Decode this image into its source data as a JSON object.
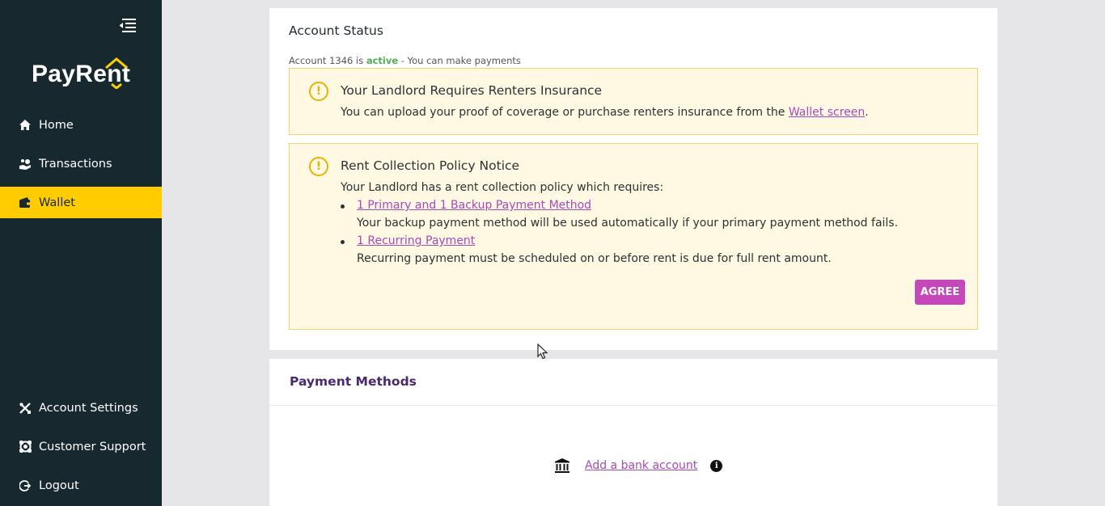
{
  "sidebar": {
    "brand": "PayRent",
    "items": [
      {
        "label": "Home",
        "icon": "home-icon"
      },
      {
        "label": "Transactions",
        "icon": "hand-coin-icon"
      },
      {
        "label": "Wallet",
        "icon": "wallet-icon"
      }
    ],
    "bottom_items": [
      {
        "label": "Account Settings",
        "icon": "tools-icon"
      },
      {
        "label": "Customer Support",
        "icon": "support-icon"
      },
      {
        "label": "Logout",
        "icon": "logout-icon"
      }
    ],
    "active_item": "Wallet"
  },
  "account_status": {
    "title": "Account Status",
    "line_prefix": "Account 1346 is ",
    "line_status": "active",
    "line_suffix": " - You can make payments"
  },
  "insurance_alert": {
    "heading": "Your Landlord Requires Renters Insurance",
    "body_prefix": "You can upload your proof of coverage or purchase renters insurance from the ",
    "body_link": "Wallet screen",
    "body_suffix": "."
  },
  "policy_alert": {
    "heading": "Rent Collection Policy Notice",
    "intro": "Your Landlord has a rent collection policy which requires:",
    "requirements": [
      {
        "link": "1 Primary and 1 Backup Payment Method",
        "description": "Your backup payment method will be used automatically if your primary payment method fails."
      },
      {
        "link": "1 Recurring Payment",
        "description": "Recurring payment must be scheduled on or before rent is due for full rent amount."
      }
    ],
    "agree_label": "AGREE"
  },
  "payment_methods": {
    "title": "Payment Methods",
    "add_bank_label": "Add a bank account",
    "info_glyph": "i"
  },
  "colors": {
    "sidebar_bg": "#17282f",
    "active_nav": "#ffcc00",
    "accent_purple": "#c547b9",
    "link": "#a54ab7",
    "alert_bg": "#fff9e3",
    "status_active": "#4caf50"
  }
}
